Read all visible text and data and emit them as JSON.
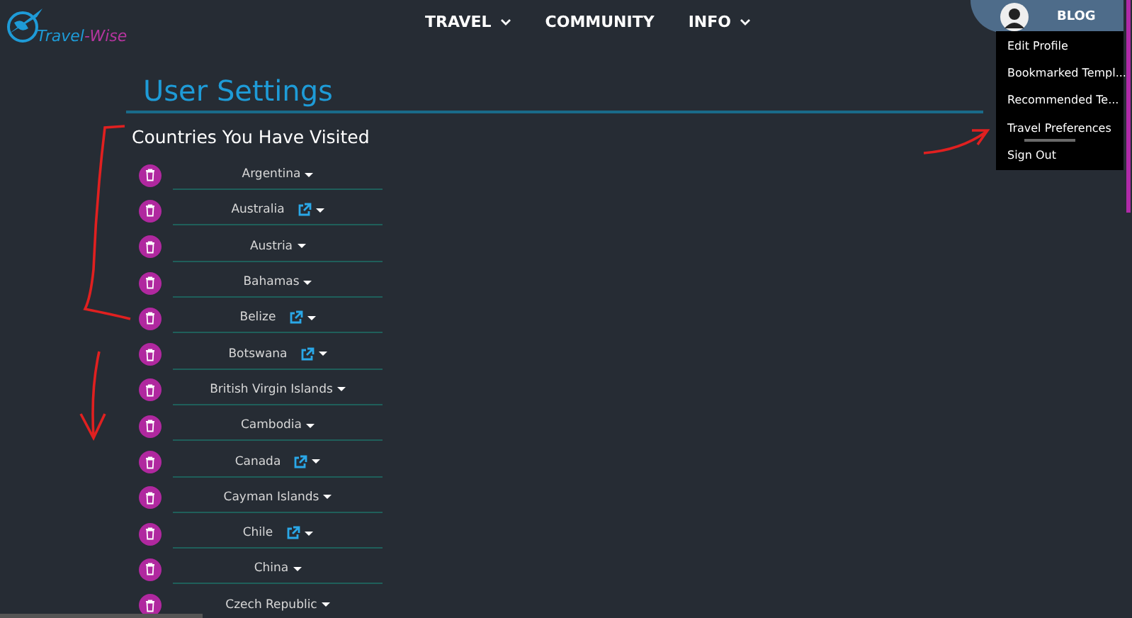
{
  "logo": {
    "first": "Travel",
    "separator": "-",
    "second": "Wise"
  },
  "nav": [
    {
      "label": "TRAVEL",
      "dropdown": true
    },
    {
      "label": "COMMUNITY",
      "dropdown": false
    },
    {
      "label": "INFO",
      "dropdown": true
    }
  ],
  "account": {
    "label": "BLOG",
    "menu": [
      {
        "label": "Edit Profile",
        "selected": false
      },
      {
        "label": "Bookmarked Templ...",
        "selected": false
      },
      {
        "label": "Recommended Te...",
        "selected": false
      },
      {
        "label": "Travel Preferences",
        "selected": true
      },
      {
        "label": "Sign Out",
        "selected": false
      }
    ]
  },
  "title": "User Settings",
  "subtitle": "Countries You Have Visited",
  "countries": [
    {
      "name": "Argentina",
      "link": false
    },
    {
      "name": "Australia",
      "link": true
    },
    {
      "name": "Austria",
      "link": false
    },
    {
      "name": "Bahamas",
      "link": false
    },
    {
      "name": "Belize",
      "link": true
    },
    {
      "name": "Botswana",
      "link": true
    },
    {
      "name": "British Virgin Islands",
      "link": false
    },
    {
      "name": "Cambodia",
      "link": false
    },
    {
      "name": "Canada",
      "link": true
    },
    {
      "name": "Cayman Islands",
      "link": false
    },
    {
      "name": "Chile",
      "link": true
    },
    {
      "name": "China",
      "link": false
    },
    {
      "name": "Czech Republic",
      "link": false
    }
  ]
}
